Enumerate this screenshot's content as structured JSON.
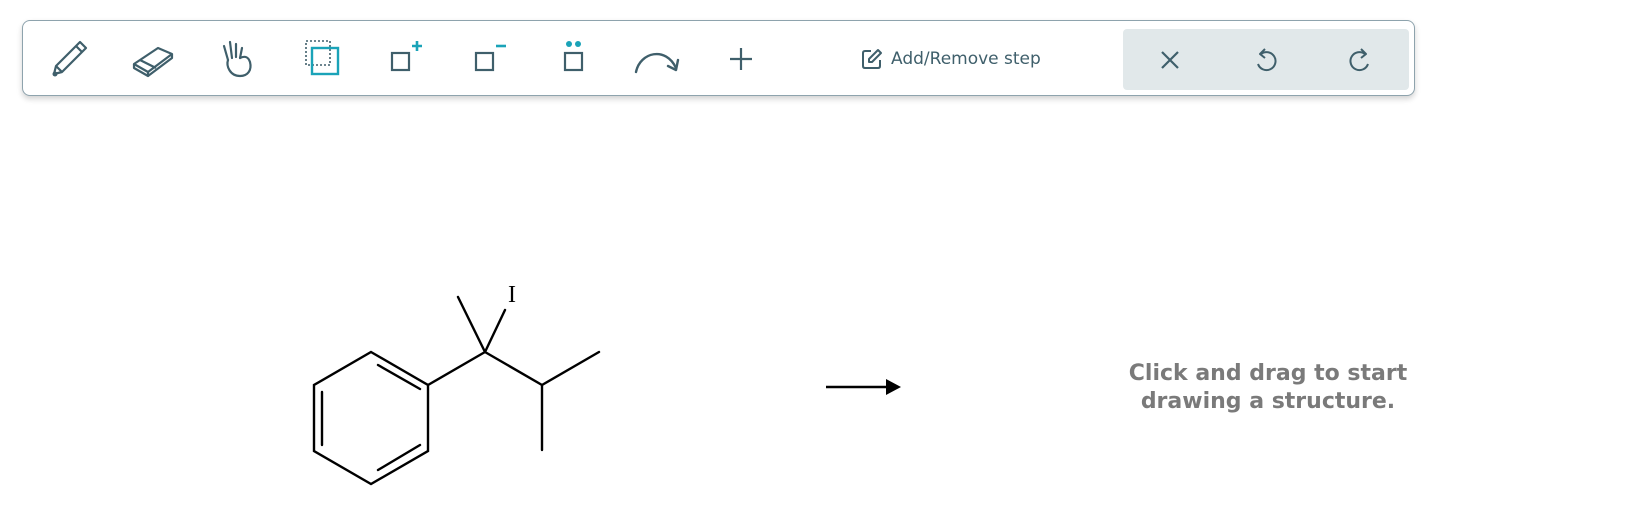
{
  "toolbar": {
    "tools": [
      {
        "name": "pencil-icon",
        "label": "Draw"
      },
      {
        "name": "eraser-icon",
        "label": "Erase"
      },
      {
        "name": "hand-icon",
        "label": "Move"
      },
      {
        "name": "select-icon",
        "label": "Select"
      },
      {
        "name": "add-charge-icon",
        "label": "Positive charge"
      },
      {
        "name": "remove-charge-icon",
        "label": "Negative charge"
      },
      {
        "name": "lone-pair-icon",
        "label": "Lone pair"
      },
      {
        "name": "curved-arrow-icon",
        "label": "Curved arrow"
      },
      {
        "name": "plus-icon",
        "label": "Add"
      }
    ],
    "step_button_label": "Add/Remove step",
    "actions": [
      {
        "name": "clear-icon",
        "label": "Clear"
      },
      {
        "name": "undo-icon",
        "label": "Undo"
      },
      {
        "name": "redo-icon",
        "label": "Redo"
      }
    ]
  },
  "molecule": {
    "atom_label": "I"
  },
  "hint": {
    "line1": "Click and drag to start",
    "line2": "drawing a structure."
  },
  "colors": {
    "icon": "#3f5f6b",
    "accent": "#1aa3b8",
    "action_bg": "#e1e8ea",
    "hint_text": "#7a7a7a"
  }
}
